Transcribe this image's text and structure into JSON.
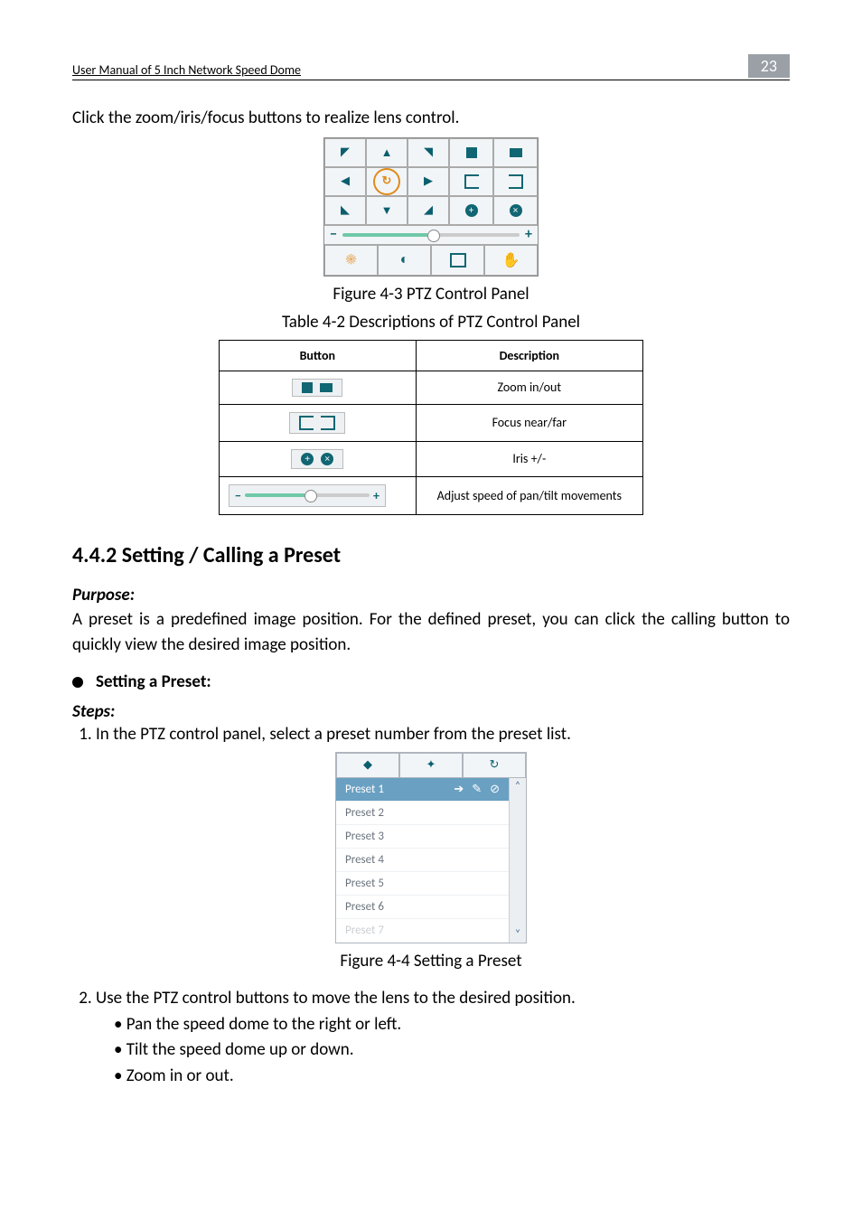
{
  "header": {
    "title": "User Manual of 5 Inch Network Speed Dome",
    "page": "23"
  },
  "intro_line": "Click the zoom/iris/focus buttons to realize lens control.",
  "fig_ptz_caption": "Figure 4-3 PTZ Control Panel",
  "table_caption": "Table 4-2 Descriptions of PTZ Control Panel",
  "table": {
    "headers": [
      "Button",
      "Description"
    ],
    "rows": [
      {
        "desc": "Zoom in/out"
      },
      {
        "desc": "Focus near/far"
      },
      {
        "desc": "Iris +/-"
      },
      {
        "desc": "Adjust speed of pan/tilt movements"
      }
    ]
  },
  "section_442": "4.4.2  Setting / Calling a Preset",
  "purpose_label": "Purpose:",
  "purpose_text": "A preset is a predefined image position. For the defined preset, you can click the calling button to quickly view the desired image position.",
  "setting_head": "Setting a Preset:",
  "steps_label": "Steps:",
  "step1": "In the PTZ control panel, select a preset number from the preset list.",
  "presets": [
    "Preset 1",
    "Preset 2",
    "Preset 3",
    "Preset 4",
    "Preset 5",
    "Preset 6",
    "Preset 7"
  ],
  "fig_preset_caption": "Figure 4-4 Setting a Preset",
  "step2": "Use the PTZ control buttons to move the lens to the desired position.",
  "sub_bullets": [
    "• Pan the speed dome to the right or left.",
    "• Tilt the speed dome up or down.",
    "• Zoom in or out."
  ],
  "ptz_icons": {
    "tree": "tree-icon",
    "bush": "bush-icon",
    "focus_near": "focus-near-icon",
    "focus_far": "focus-far-icon",
    "iris_open": "iris-open-icon",
    "iris_close": "iris-close-icon",
    "minus": "−",
    "plus": "+",
    "light": "light-icon",
    "wiper": "wiper-icon",
    "aux": "aux-focus-icon",
    "init": "lens-init-icon",
    "auto": "↻"
  }
}
